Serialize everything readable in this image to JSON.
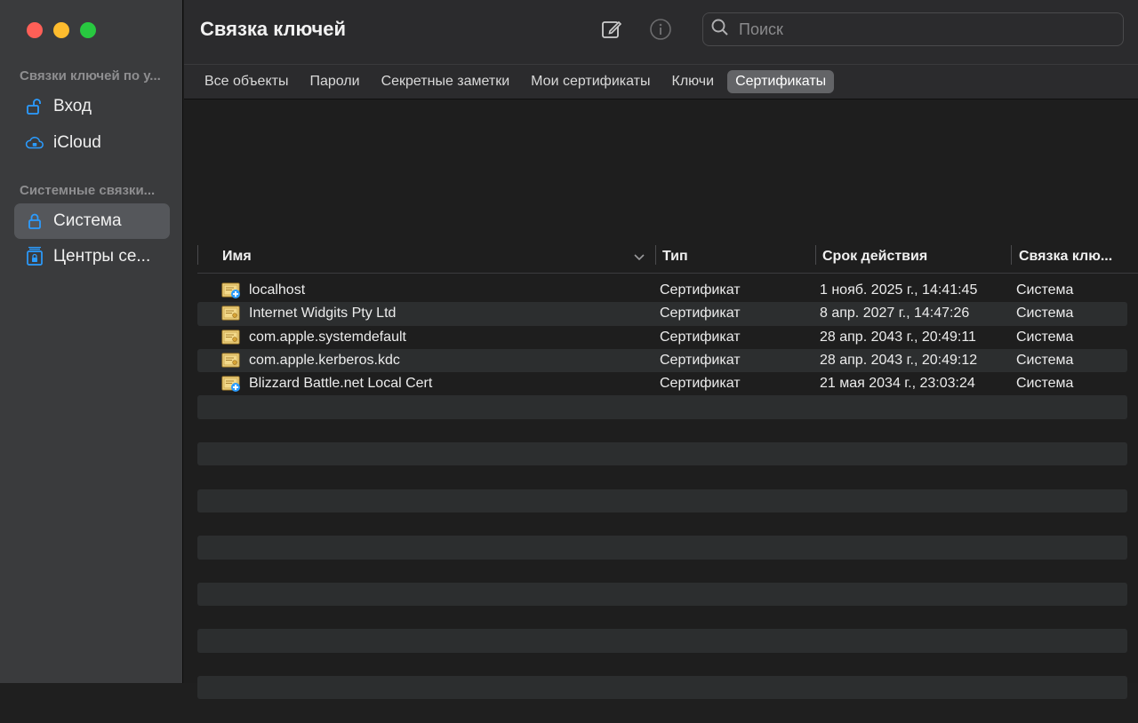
{
  "window": {
    "title": "Связка ключей",
    "controls": [
      "close",
      "minimize",
      "zoom"
    ],
    "colors": {
      "close": "#fe5f57",
      "minimize": "#febc2e",
      "zoom": "#28c840",
      "accent_icon": "#2b9cff"
    }
  },
  "sidebar": {
    "section1_label": "Связки ключей по у...",
    "section1_items": [
      {
        "label": "Вход",
        "icon": "lock-open-icon"
      },
      {
        "label": "iCloud",
        "icon": "cloud-lock-icon"
      }
    ],
    "section2_label": "Системные связки...",
    "section2_items": [
      {
        "label": "Система",
        "icon": "lock-icon",
        "selected": true
      },
      {
        "label": "Центры се...",
        "icon": "cabinet-lock-icon"
      }
    ]
  },
  "toolbar": {
    "compose_icon": "compose-icon",
    "info_icon": "info-icon",
    "search_placeholder": "Поиск"
  },
  "tabs": [
    {
      "label": "Все объекты",
      "active": false
    },
    {
      "label": "Пароли",
      "active": false
    },
    {
      "label": "Секретные заметки",
      "active": false
    },
    {
      "label": "Мои сертификаты",
      "active": false
    },
    {
      "label": "Ключи",
      "active": false
    },
    {
      "label": "Сертификаты",
      "active": true
    }
  ],
  "table": {
    "columns": {
      "name": "Имя",
      "type": "Тип",
      "expires": "Срок действия",
      "keychain": "Связка клю..."
    },
    "sort_column": "name",
    "rows": [
      {
        "name": "localhost",
        "type": "Сертификат",
        "expires": "1 нояб. 2025 г., 14:41:45",
        "keychain": "Система",
        "icon": "certificate-custom-icon"
      },
      {
        "name": "Internet Widgits Pty Ltd",
        "type": "Сертификат",
        "expires": "8 апр. 2027 г., 14:47:26",
        "keychain": "Система",
        "icon": "certificate-icon"
      },
      {
        "name": "com.apple.systemdefault",
        "type": "Сертификат",
        "expires": "28 апр. 2043 г., 20:49:11",
        "keychain": "Система",
        "icon": "certificate-icon"
      },
      {
        "name": "com.apple.kerberos.kdc",
        "type": "Сертификат",
        "expires": "28 апр. 2043 г., 20:49:12",
        "keychain": "Система",
        "icon": "certificate-icon"
      },
      {
        "name": "Blizzard Battle.net Local Cert",
        "type": "Сертификат",
        "expires": "21 мая 2034 г., 23:03:24",
        "keychain": "Система",
        "icon": "certificate-custom-icon"
      }
    ]
  }
}
